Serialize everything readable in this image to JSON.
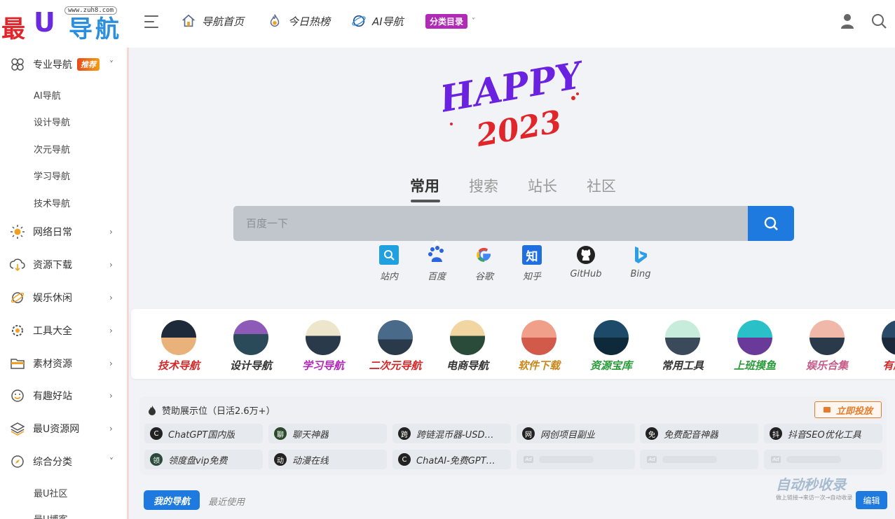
{
  "logo": {
    "url_badge": "www.zuh8.com",
    "chars": [
      "最",
      "U",
      "导航"
    ]
  },
  "topnav": [
    {
      "label": "导航首页",
      "icon": "home-icon"
    },
    {
      "label": "今日热榜",
      "icon": "fire-icon"
    },
    {
      "label": "AI导航",
      "icon": "ai-globe-icon"
    }
  ],
  "category_menu": {
    "label": "分类目录",
    "caret": "˅"
  },
  "sidebar": {
    "pro_nav": {
      "label": "专业导航",
      "badge": "推荐",
      "arrow": "˅"
    },
    "pro_sub": [
      "AI导航",
      "设计导航",
      "次元导航",
      "学习导航",
      "技术导航"
    ],
    "groups": [
      {
        "label": "网络日常",
        "icon": "sun-icon",
        "arrow": "›"
      },
      {
        "label": "资源下载",
        "icon": "cloud-download-icon",
        "arrow": "›"
      },
      {
        "label": "娱乐休闲",
        "icon": "planet-icon",
        "arrow": "›"
      },
      {
        "label": "工具大全",
        "icon": "gear-icon",
        "arrow": "›"
      },
      {
        "label": "素材资源",
        "icon": "folder-icon",
        "arrow": "›"
      },
      {
        "label": "有趣好站",
        "icon": "smile-icon",
        "arrow": "›"
      },
      {
        "label": "最U资源网",
        "icon": "layers-icon",
        "arrow": "›"
      },
      {
        "label": "综合分类",
        "icon": "compass-icon",
        "arrow": "˅"
      }
    ],
    "general_sub": [
      "最U社区",
      "最U博客"
    ]
  },
  "hero": {
    "art_line1": "HAPPY",
    "art_line2": "2023",
    "tabs": [
      "常用",
      "搜索",
      "站长",
      "社区"
    ],
    "search_placeholder": "百度一下",
    "engines": [
      {
        "label": "站内",
        "icon": "site-search-icon"
      },
      {
        "label": "百度",
        "icon": "baidu-paw-icon"
      },
      {
        "label": "谷歌",
        "icon": "google-icon"
      },
      {
        "label": "知乎",
        "icon": "zhihu-icon"
      },
      {
        "label": "GitHub",
        "icon": "github-icon"
      },
      {
        "label": "Bing",
        "icon": "bing-icon"
      }
    ]
  },
  "categories": [
    {
      "label": "技术导航",
      "color": "#d22a2a"
    },
    {
      "label": "设计导航",
      "color": "#333333"
    },
    {
      "label": "学习导航",
      "color": "#b02ab7"
    },
    {
      "label": "二次元导航",
      "color": "#d22a2a"
    },
    {
      "label": "电商导航",
      "color": "#333333"
    },
    {
      "label": "软件下载",
      "color": "#c9861a"
    },
    {
      "label": "资源宝库",
      "color": "#2a9a3a"
    },
    {
      "label": "常用工具",
      "color": "#333333"
    },
    {
      "label": "上班摸鱼",
      "color": "#2a9a3a"
    },
    {
      "label": "娱乐合集",
      "color": "#c75b8a"
    },
    {
      "label": "有趣...",
      "color": "#d22a2a"
    }
  ],
  "sponsor": {
    "title": "赞助展示位（日活2.6万+）",
    "button": "立即投放",
    "row1": [
      {
        "dot": "C",
        "label": "ChatGPT国内版"
      },
      {
        "dot": "聊",
        "label": "聊天神器"
      },
      {
        "dot": "跨",
        "label": "跨链混币器-USD…"
      },
      {
        "dot": "网",
        "label": "网创项目副业"
      },
      {
        "dot": "免",
        "label": "免费配音神器"
      },
      {
        "dot": "抖",
        "label": "抖音SEO优化工具"
      }
    ],
    "row2": [
      {
        "dot": "领",
        "label": "领度盘vip免费"
      },
      {
        "dot": "动",
        "label": "动漫在线"
      },
      {
        "dot": "C",
        "label": "ChatAI-免费GPT…"
      }
    ],
    "ad_tag": "Ad"
  },
  "bottom": {
    "my_nav": "我的导航",
    "recent": "最近使用",
    "edit": "编辑"
  },
  "watermark": {
    "line1": "自动秒收录",
    "line2": "做上链接→来访一次→自动收录"
  }
}
